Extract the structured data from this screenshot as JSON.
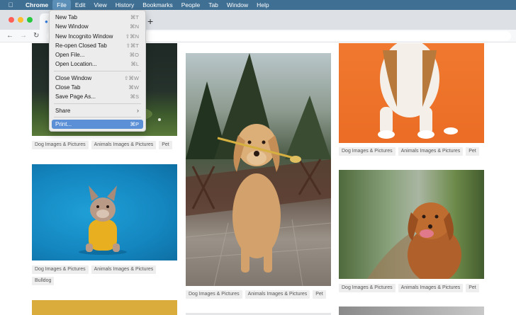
{
  "menubar": {
    "items": [
      "Chrome",
      "File",
      "Edit",
      "View",
      "History",
      "Bookmarks",
      "People",
      "Tab",
      "Window",
      "Help"
    ]
  },
  "browser": {
    "new_tab_symbol": "+",
    "back_symbol": "←",
    "forward_symbol": "→",
    "reload_symbol": "↻"
  },
  "file_menu": {
    "new_tab": {
      "label": "New Tab",
      "shortcut": "⌘T"
    },
    "new_window": {
      "label": "New Window",
      "shortcut": "⌘N"
    },
    "new_incognito": {
      "label": "New Incognito Window",
      "shortcut": "⇧⌘N"
    },
    "reopen_tab": {
      "label": "Re-open Closed Tab",
      "shortcut": "⇧⌘T"
    },
    "open_file": {
      "label": "Open File...",
      "shortcut": "⌘O"
    },
    "open_location": {
      "label": "Open Location...",
      "shortcut": "⌘L"
    },
    "close_window": {
      "label": "Close Window",
      "shortcut": "⇧⌘W"
    },
    "close_tab": {
      "label": "Close Tab",
      "shortcut": "⌘W"
    },
    "save_page": {
      "label": "Save Page As...",
      "shortcut": "⌘S"
    },
    "share": {
      "label": "Share",
      "arrow": "›"
    },
    "print": {
      "label": "Print...",
      "shortcut": "⌘P"
    }
  },
  "gallery": {
    "col1": {
      "card1_tags": [
        "Dog Images & Pictures",
        "Animals Images & Pictures",
        "Pet"
      ],
      "card2_tags": [
        "Dog Images & Pictures",
        "Animals Images & Pictures",
        "Bulldog"
      ]
    },
    "col2": {
      "card1_tags": [
        "Dog Images & Pictures",
        "Animals Images & Pictures",
        "Pet"
      ]
    },
    "col3": {
      "card1_tags": [
        "Dog Images & Pictures",
        "Animals Images & Pictures",
        "Pet"
      ],
      "card2_tags": [
        "Dog Images & Pictures",
        "Animals Images & Pictures",
        "Pet"
      ]
    }
  }
}
